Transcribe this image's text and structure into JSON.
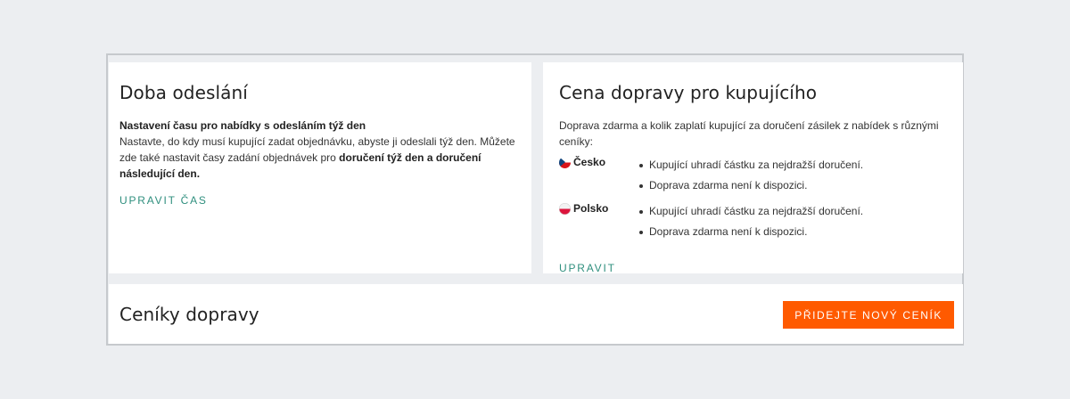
{
  "dispatch": {
    "title": "Doba odeslání",
    "subheading": "Nastavení času pro nabídky s odesláním týž den",
    "text_before": "Nastavte, do kdy musí kupující zadat objednávku, abyste ji odeslali týž den. Můžete zde také nastavit časy zadání objednávek pro ",
    "text_bold": "doručení týž den a doručení následující den.",
    "link": "UPRAVIT ČAS"
  },
  "shipping_price": {
    "title": "Cena dopravy pro kupujícího",
    "intro": "Doprava zdarma a kolik zaplatí kupující za doručení zásilek z nabídek s různými ceníky:",
    "countries": [
      {
        "name": "Česko",
        "flag": "cz-flag-icon",
        "items": [
          "Kupující uhradí částku za nejdražší doručení.",
          "Doprava zdarma není k dispozici."
        ]
      },
      {
        "name": "Polsko",
        "flag": "pl-flag-icon",
        "items": [
          "Kupující uhradí částku za nejdražší doručení.",
          "Doprava zdarma není k dispozici."
        ]
      }
    ],
    "link": "UPRAVIT"
  },
  "price_lists": {
    "title": "Ceníky dopravy",
    "add_button": "PŘIDEJTE NOVÝ CENÍK"
  },
  "colors": {
    "accent": "#ff5a00",
    "link": "#2f8f7e",
    "background": "#eceef1"
  }
}
